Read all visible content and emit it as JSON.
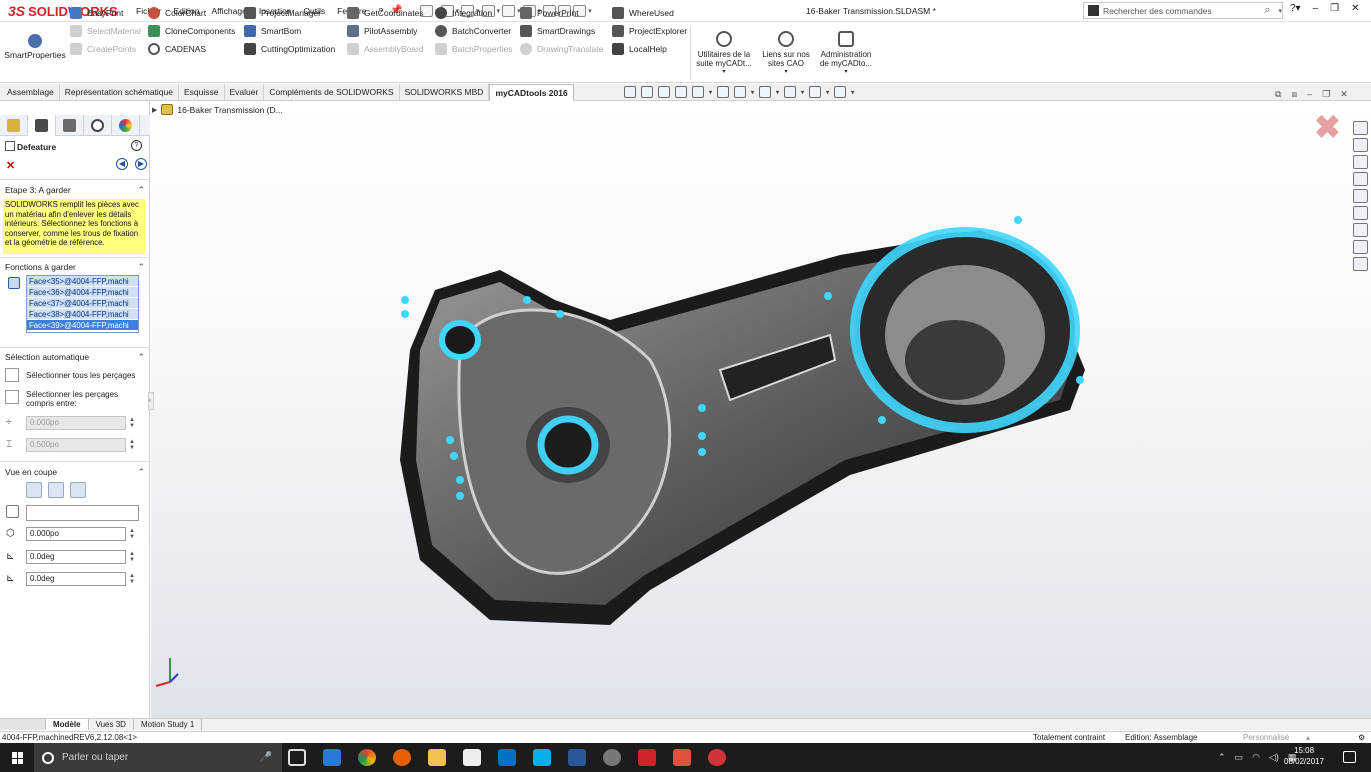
{
  "app": {
    "brand": "SOLIDWORKS",
    "doc_title": "16-Baker Transmission.SLDASM *"
  },
  "menu": [
    "Fichier",
    "Edition",
    "Affichage",
    "Insertion",
    "Outils",
    "Fenêtre",
    "?"
  ],
  "search": {
    "placeholder": "Rechercher des commandes"
  },
  "ribbon": {
    "smart_properties": "SmartProperties",
    "col1": [
      {
        "label": "EasyPrint",
        "enabled": true
      },
      {
        "label": "SelectMaterial",
        "enabled": false
      },
      {
        "label": "CreatePoints",
        "enabled": false
      }
    ],
    "col2": [
      {
        "label": "ColorChart",
        "enabled": true
      },
      {
        "label": "CloneComponents",
        "enabled": true
      },
      {
        "label": "CADENAS",
        "enabled": true
      }
    ],
    "col3": [
      {
        "label": "ProjectManager",
        "enabled": true
      },
      {
        "label": "SmartBom",
        "enabled": true
      },
      {
        "label": "CuttingOptimization",
        "enabled": true
      }
    ],
    "col4": [
      {
        "label": "GetCoordinates",
        "enabled": true
      },
      {
        "label": "PilotAssembly",
        "enabled": true
      },
      {
        "label": "AssemblyBoard",
        "enabled": false
      }
    ],
    "col5": [
      {
        "label": "Integration",
        "enabled": true
      },
      {
        "label": "BatchConverter",
        "enabled": true
      },
      {
        "label": "BatchProperties",
        "enabled": false
      }
    ],
    "col6": [
      {
        "label": "PowerPrint",
        "enabled": true
      },
      {
        "label": "SmartDrawings",
        "enabled": true
      },
      {
        "label": "DrawingTranslate",
        "enabled": false
      }
    ],
    "col7": [
      {
        "label": "WhereUsed",
        "enabled": true
      },
      {
        "label": "ProjectExplorer",
        "enabled": true
      },
      {
        "label": "LocalHelp",
        "enabled": true
      }
    ],
    "big1": "Utilitaires de la suite myCADt...",
    "big2": "Liens sur nos sites CAO",
    "big3": "Administration de myCADto..."
  },
  "tabs": [
    "Assemblage",
    "Représentation schématique",
    "Esquisse",
    "Evaluer",
    "Compléments de SOLIDWORKS",
    "SOLIDWORKS MBD",
    "myCADtools 2016"
  ],
  "active_tab": "myCADtools 2016",
  "panel": {
    "title": "Defeature",
    "step_title": "Etape 3: A garder",
    "tip": "SOLIDWORKS remplit les pièces avec un matériau afin d'enlever les détails intérieurs. Sélectionnez les fonctions à conserver, comme les trous de fixation et la géométrie de référence.",
    "functions_title": "Fonctions à garder",
    "faces": [
      "Face<35>@4004-FFP,machi",
      "Face<36>@4004-FFP,machi",
      "Face<37>@4004-FFP,machi",
      "Face<38>@4004-FFP,machi",
      "Face<39>@4004-FFP,machi"
    ],
    "auto_title": "Sélection automatique",
    "select_all": "Sélectionner tous les perçages",
    "select_between_1": "Sélectionner les perçages",
    "select_between_2": "compris entre:",
    "min_val": "0.000po",
    "max_val": "0.500po",
    "section_title": "Vue en coupe",
    "offset_val": "0.000po",
    "angle1": "0.0deg",
    "angle2": "0.0deg",
    "sel_field": ""
  },
  "viewport": {
    "tree_root": "16-Baker Transmission  (D..."
  },
  "bottom_tabs": [
    "Modèle",
    "Vues 3D",
    "Motion Study 1"
  ],
  "active_bottom_tab": "Modèle",
  "status": {
    "left": "4004-FFP,machinedREV6,2.12.08<1>",
    "constraint": "Totalement contraint",
    "mode": "Edition: Assemblage",
    "custom": "Personnalisé"
  },
  "taskbar": {
    "search_placeholder": "Parler ou taper",
    "time": "15:08",
    "date": "08/02/2017"
  },
  "colors": {
    "accent_red": "#d1232a",
    "highlight_cyan": "#3fd7ff",
    "tip_yellow": "#ffff80"
  }
}
